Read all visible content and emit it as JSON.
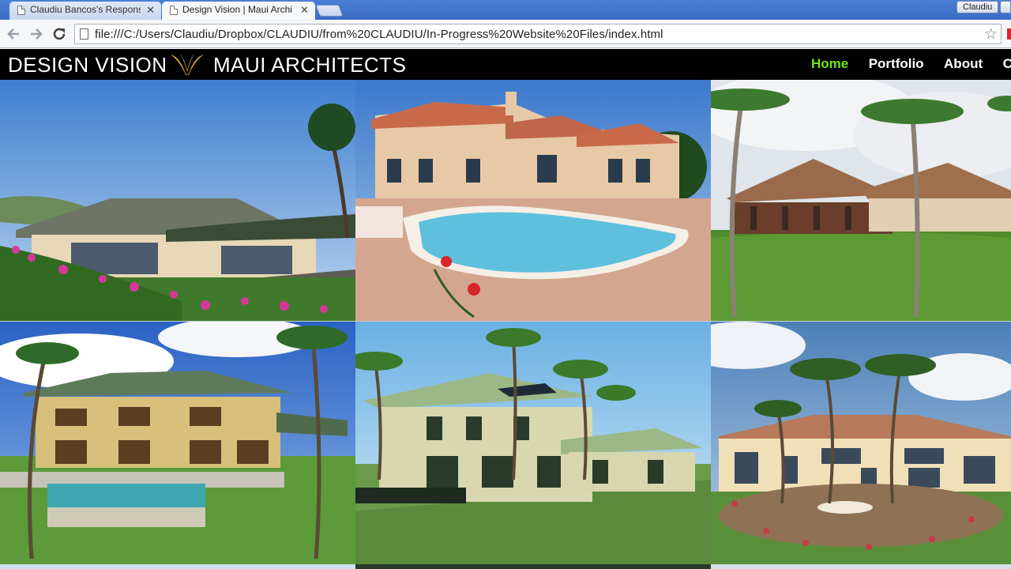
{
  "browser": {
    "tabs": [
      {
        "label": "Claudiu Bancos's Responsi",
        "active": false
      },
      {
        "label": "Design Vision | Maui Archi",
        "active": true
      }
    ],
    "close_glyph": "✕",
    "profile_name": "Claudiu",
    "url": "file:///C:/Users/Claudiu/Dropbox/CLAUDIU/from%20CLAUDIU/In-Progress%20Website%20Files/index.html",
    "icons": {
      "back": "back-arrow-icon",
      "forward": "forward-arrow-icon",
      "reload": "reload-icon",
      "bookmark": "star-icon"
    }
  },
  "site": {
    "brand_left": "DESIGN VISION",
    "brand_right": "MAUI ARCHITECTS",
    "logo_color": "#c9a227",
    "nav": [
      {
        "label": "Home",
        "active": true
      },
      {
        "label": "Portfolio",
        "active": false
      },
      {
        "label": "About",
        "active": false
      },
      {
        "label": "Co",
        "active": false
      }
    ],
    "accent_color": "#6fe617"
  },
  "gallery": {
    "tiles": [
      {
        "subject": "single-story hip-roof home with infinity pool and pink flower garden"
      },
      {
        "subject": "Mediterranean villa with freeform swimming pool and red roses"
      },
      {
        "subject": "Balinese-style pavilion home with palm trees and lawn"
      },
      {
        "subject": "two-story green-roof home with lap pool rendering"
      },
      {
        "subject": "plantation-style two-story home with palm trees rendering"
      },
      {
        "subject": "cream estate with fountain and circular drive rendering"
      }
    ]
  }
}
